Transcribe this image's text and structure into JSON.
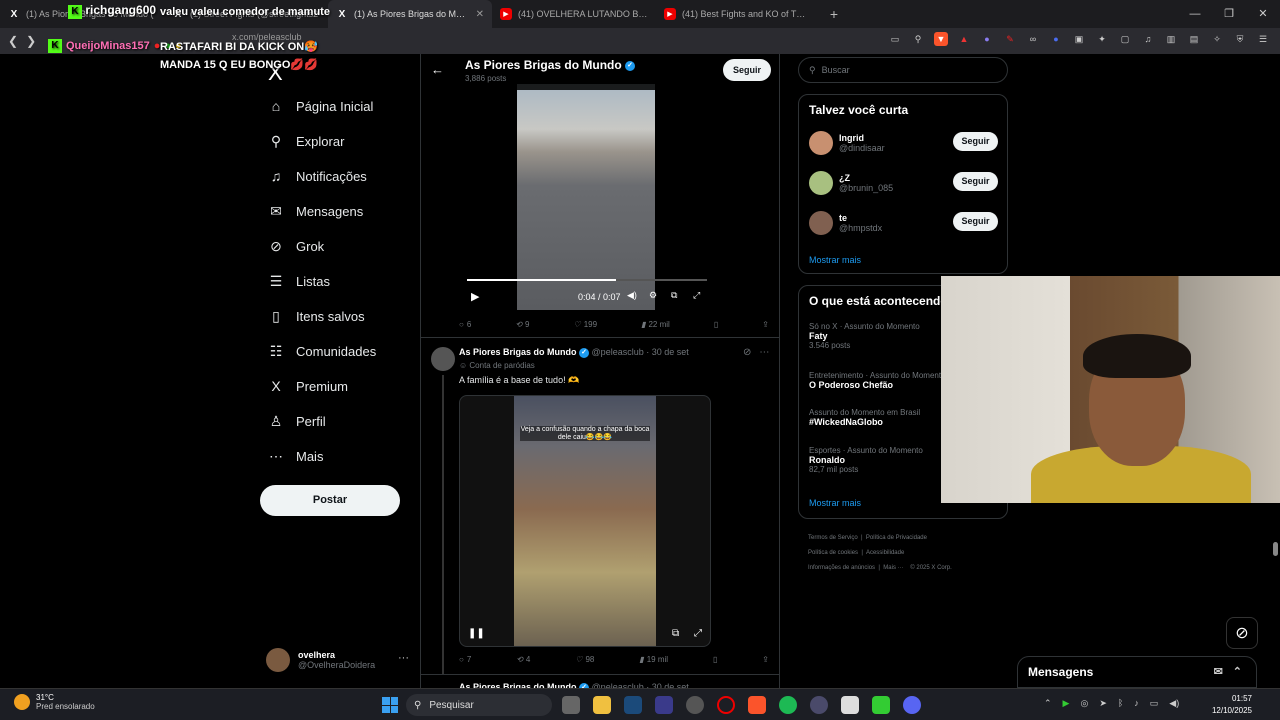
{
  "browser": {
    "tabs": [
      {
        "title": "(1) As Piores Brigas do Mundo (",
        "icon": "x"
      },
      {
        "title": "(1) Street Fights (@streetfights2",
        "icon": "x"
      },
      {
        "title": "(1) As Piores Brigas do Mundo (@",
        "icon": "x"
      },
      {
        "title": "(41) OVELHERA LUTANDO BOXE KKKK",
        "icon": "yt"
      },
      {
        "title": "(41) Best Fights and KO of TOP DOG",
        "icon": "yt"
      }
    ],
    "new_tab": "+",
    "url": "x.com/peleasclub"
  },
  "stream_overlay": {
    "line1_user": "richgang600",
    "line1_msg": "valeu valeu comedor de mamute",
    "line2_user": "QueijoMinas157",
    "line2_msg": "RASTAFARI BI DA KICK ON🥵 MANDA 15 Q EU BONGO💋💋"
  },
  "sidebar": {
    "logo": "X",
    "items": [
      {
        "label": "Página Inicial",
        "icon": "home-icon",
        "glyph": "⌂"
      },
      {
        "label": "Explorar",
        "icon": "search-icon",
        "glyph": "⚲"
      },
      {
        "label": "Notificações",
        "icon": "bell-icon",
        "glyph": "♫"
      },
      {
        "label": "Mensagens",
        "icon": "mail-icon",
        "glyph": "✉"
      },
      {
        "label": "Grok",
        "icon": "grok-icon",
        "glyph": "⊘"
      },
      {
        "label": "Listas",
        "icon": "list-icon",
        "glyph": "☰"
      },
      {
        "label": "Itens salvos",
        "icon": "bookmark-icon",
        "glyph": "▯"
      },
      {
        "label": "Comunidades",
        "icon": "communities-icon",
        "glyph": "☷"
      },
      {
        "label": "Premium",
        "icon": "premium-icon",
        "glyph": "X"
      },
      {
        "label": "Perfil",
        "icon": "profile-icon",
        "glyph": "♙"
      },
      {
        "label": "Mais",
        "icon": "more-icon",
        "glyph": "⋯"
      }
    ],
    "post_button": "Postar",
    "account": {
      "name": "ovelhera",
      "handle": "@OvelheraDoidera",
      "more": "···"
    }
  },
  "feed": {
    "title": "As Piores Brigas do Mundo",
    "posts_count": "3,886 posts",
    "follow_label": "Seguir",
    "video1": {
      "time": "0:04 / 0:07",
      "progress": 0.62
    },
    "tweet1_actions": {
      "replies": "6",
      "reposts": "9",
      "likes": "199",
      "views": "22 mil"
    },
    "tweet2": {
      "name": "As Piores Brigas do Mundo",
      "handle": "@peleasclub · 30 de set",
      "label": "Conta de paródias",
      "text": "A família é a base de tudo! 🫶",
      "video_caption": "Veja a confusão quando a chapa da boca dele caiu😂😂😂",
      "actions": {
        "replies": "7",
        "reposts": "4",
        "likes": "98",
        "views": "19 mil"
      }
    },
    "tweet3": {
      "name": "As Piores Brigas do Mundo",
      "handle": "@peleasclub · 30 de set"
    }
  },
  "right": {
    "search_placeholder": "Buscar",
    "suggest_title": "Talvez você curta",
    "suggestions": [
      {
        "name": "Ingrid",
        "handle": "@dindisaar",
        "color": "#c89070"
      },
      {
        "name": "¿Z",
        "handle": "@brunin_085",
        "color": "#a8c080"
      },
      {
        "name": "te",
        "handle": "@hmpstdx",
        "color": "#806050"
      }
    ],
    "follow_label": "Seguir",
    "show_more": "Mostrar mais",
    "trends_title": "O que está acontecendo",
    "trends": [
      {
        "context": "Só no X · Assunto do Momento",
        "name": "Faty",
        "count": "3.546 posts"
      },
      {
        "context": "Entretenimento · Assunto do Momento",
        "name": "O Poderoso Chefão",
        "count": ""
      },
      {
        "context": "Assunto do Momento em Brasil",
        "name": "#WickedNaGlobo",
        "count": ""
      },
      {
        "context": "Esportes · Assunto do Momento",
        "name": "Ronaldo",
        "count": "82,7 mil posts"
      }
    ],
    "trends_more": "Mostrar mais",
    "footer": [
      "Termos de Serviço",
      "Política de Privacidade",
      "Política de cookies",
      "Acessibilidade",
      "Informações de anúncios",
      "Mais ···",
      "© 2025 X Corp."
    ]
  },
  "messages_drawer": {
    "title": "Mensagens"
  },
  "taskbar": {
    "temp": "31°C",
    "weather": "Pred ensolarado",
    "search": "Pesquisar",
    "time": "01:57",
    "date": "12/10/2025"
  }
}
